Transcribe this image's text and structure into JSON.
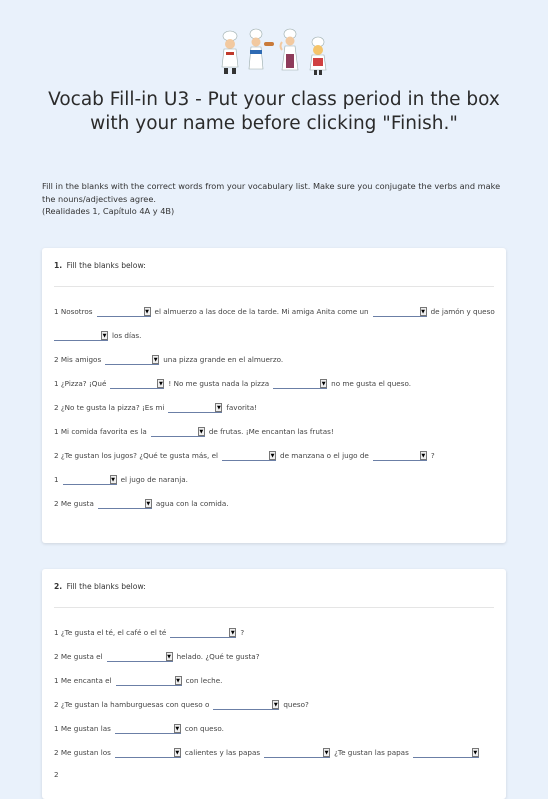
{
  "form": {
    "title": "Vocab Fill-in U3 - Put your class period in the box with your name before clicking \"Finish.\"",
    "intro_line1": "Fill in the blanks with the correct words from your vocabulary list. Make sure you conjugate the verbs and make the nouns/adjectives agree.",
    "intro_line2": "(Realidades 1, Capítulo 4A y 4B)"
  },
  "questions": [
    {
      "number": "1.",
      "prompt": "Fill the blanks below:",
      "lines": {
        "l1a": "1 Nosotros",
        "l1b": "el almuerzo a las doce de la tarde. Mi amiga Anita come un",
        "l1c": "de jamón y queso",
        "l2a": "los días.",
        "l3a": "2 Mis amigos",
        "l3b": "una pizza grande en el almuerzo.",
        "l4a": "1 ¿Pizza? ¡Qué",
        "l4b": "! No me gusta nada la pizza",
        "l4c": "no me gusta el queso.",
        "l5a": "2 ¿No te gusta la pizza? ¡Es mi",
        "l5b": "favorita!",
        "l6a": "1 Mi comida favorita es la",
        "l6b": "de frutas. ¡Me encantan las frutas!",
        "l7a": "2 ¿Te gustan los jugos? ¿Qué te gusta más, el",
        "l7b": "de manzana o el jugo de",
        "l7c": "?",
        "l8a": "1",
        "l8b": "el jugo de naranja.",
        "l9a": "2 Me gusta",
        "l9b": "agua con la comida."
      }
    },
    {
      "number": "2.",
      "prompt": "Fill the blanks below:",
      "lines": {
        "l1a": "1 ¿Te gusta el té, el café o el té",
        "l1b": "?",
        "l2a": "2 Me gusta el",
        "l2b": "helado. ¿Qué te gusta?",
        "l3a": "1 Me encanta el",
        "l3b": "con leche.",
        "l4a": "2 ¿Te gustan la hamburguesas con queso o",
        "l4b": "queso?",
        "l5a": "1 Me gustan las",
        "l5b": "con queso.",
        "l6a": "2 Me gustan los",
        "l6b": "calientes y las papas",
        "l6c": "¿Te gustan las papas",
        "l7a": "2"
      }
    }
  ],
  "dropdown_arrow": "▼",
  "icons": {
    "header": "chefs-illustration"
  }
}
